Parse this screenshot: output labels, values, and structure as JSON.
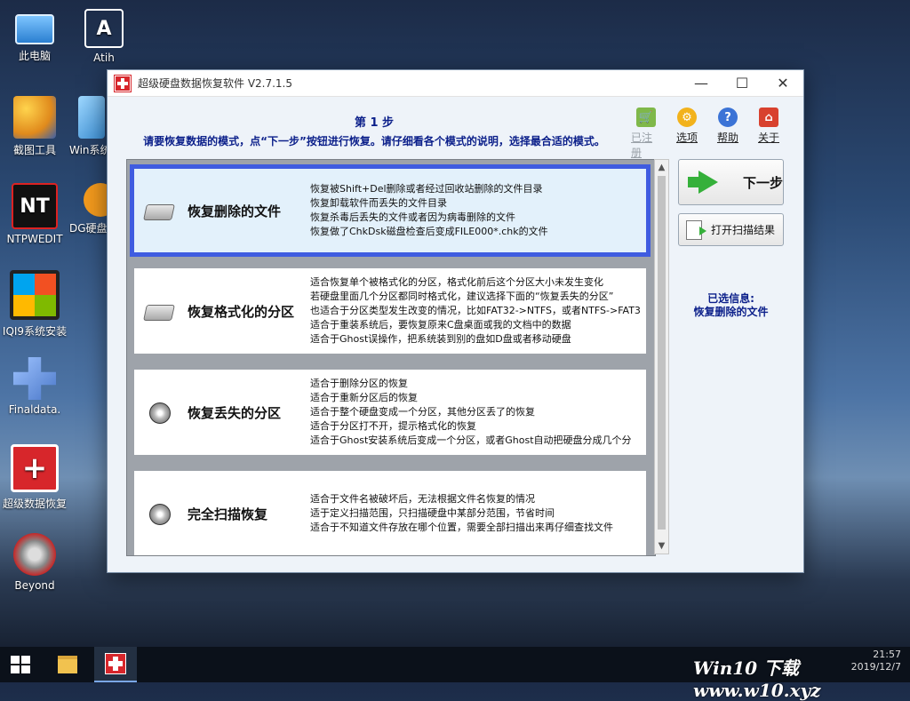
{
  "desktop": {
    "icons": [
      {
        "label": "此电脑",
        "icon": "computer-icon"
      },
      {
        "label": "Atih",
        "icon": "atih-icon",
        "glyph": "A"
      },
      {
        "label": "截图工具",
        "icon": "screenshot-tool-icon"
      },
      {
        "label": "Win系统",
        "icon": "win-system-icon"
      },
      {
        "label": "NTPWEDIT",
        "icon": "ntpwedit-icon",
        "glyph": "NT"
      },
      {
        "label": "DG硬盘",
        "icon": "diskgenius-icon"
      },
      {
        "label": "IQI9系统安装",
        "icon": "windows-logo-icon"
      },
      {
        "label": "Finaldata.",
        "icon": "finaldata-icon"
      },
      {
        "label": "超级数据恢复",
        "icon": "red-cross-icon"
      },
      {
        "label": "Beyond",
        "icon": "beyond-icon"
      }
    ]
  },
  "window": {
    "title": "超级硬盘数据恢复软件 V2.7.1.5",
    "controls": {
      "minimize": "—",
      "maximize": "☐",
      "close": "✕"
    },
    "step_title": "第 1 步",
    "step_subtitle": "请要恢复数据的模式，点“下一步”按钮进行恢复。请仔细看各个模式的说明，选择最合适的模式。",
    "toolbar": [
      {
        "label": "已注册",
        "icon": "cart-icon",
        "disabled": true
      },
      {
        "label": "选项",
        "icon": "gear-icon",
        "disabled": false
      },
      {
        "label": "帮助",
        "icon": "help-icon",
        "disabled": false
      },
      {
        "label": "关于",
        "icon": "home-icon",
        "disabled": false
      }
    ],
    "modes": [
      {
        "title": "恢复删除的文件",
        "selected": true,
        "desc": [
          "恢复被Shift+Del删除或者经过回收站删除的文件目录",
          "恢复卸载软件而丢失的文件目录",
          "恢复杀毒后丢失的文件或者因为病毒删除的文件",
          "恢复做了ChkDsk磁盘检查后变成FILE000*.chk的文件"
        ]
      },
      {
        "title": "恢复格式化的分区",
        "selected": false,
        "desc": [
          "适合恢复单个被格式化的分区，格式化前后这个分区大小未发生变化",
          "若硬盘里面几个分区都同时格式化，建议选择下面的“恢复丢失的分区”",
          "也适合于分区类型发生改变的情况，比如FAT32->NTFS，或者NTFS->FAT3",
          "适合于重装系统后，要恢复原来C盘桌面或我的文档中的数据",
          "适合于Ghost误操作，把系统装到别的盘如D盘或者移动硬盘"
        ]
      },
      {
        "title": "恢复丢失的分区",
        "selected": false,
        "desc": [
          "适合于删除分区的恢复",
          "适合于重新分区后的恢复",
          "适合于整个硬盘变成一个分区，其他分区丢了的恢复",
          "适合于分区打不开，提示格式化的恢复",
          "适合于Ghost安装系统后变成一个分区，或者Ghost自动把硬盘分成几个分"
        ]
      },
      {
        "title": "完全扫描恢复",
        "selected": false,
        "desc": [
          "适合于文件名被破坏后，无法根据文件名恢复的情况",
          "适于定义扫描范围，只扫描硬盘中某部分范围，节省时间",
          "适合于不知道文件存放在哪个位置，需要全部扫描出来再仔细查找文件"
        ]
      }
    ],
    "next_button": "下一步",
    "scan_result_button": "打开扫描结果",
    "selected_info_label": "已选信息:",
    "selected_info_value": "恢复删除的文件"
  },
  "taskbar": {
    "clock_time": "21:57",
    "clock_date": "2019/12/7",
    "watermark": "Win10 下载 www.w10.xyz"
  }
}
